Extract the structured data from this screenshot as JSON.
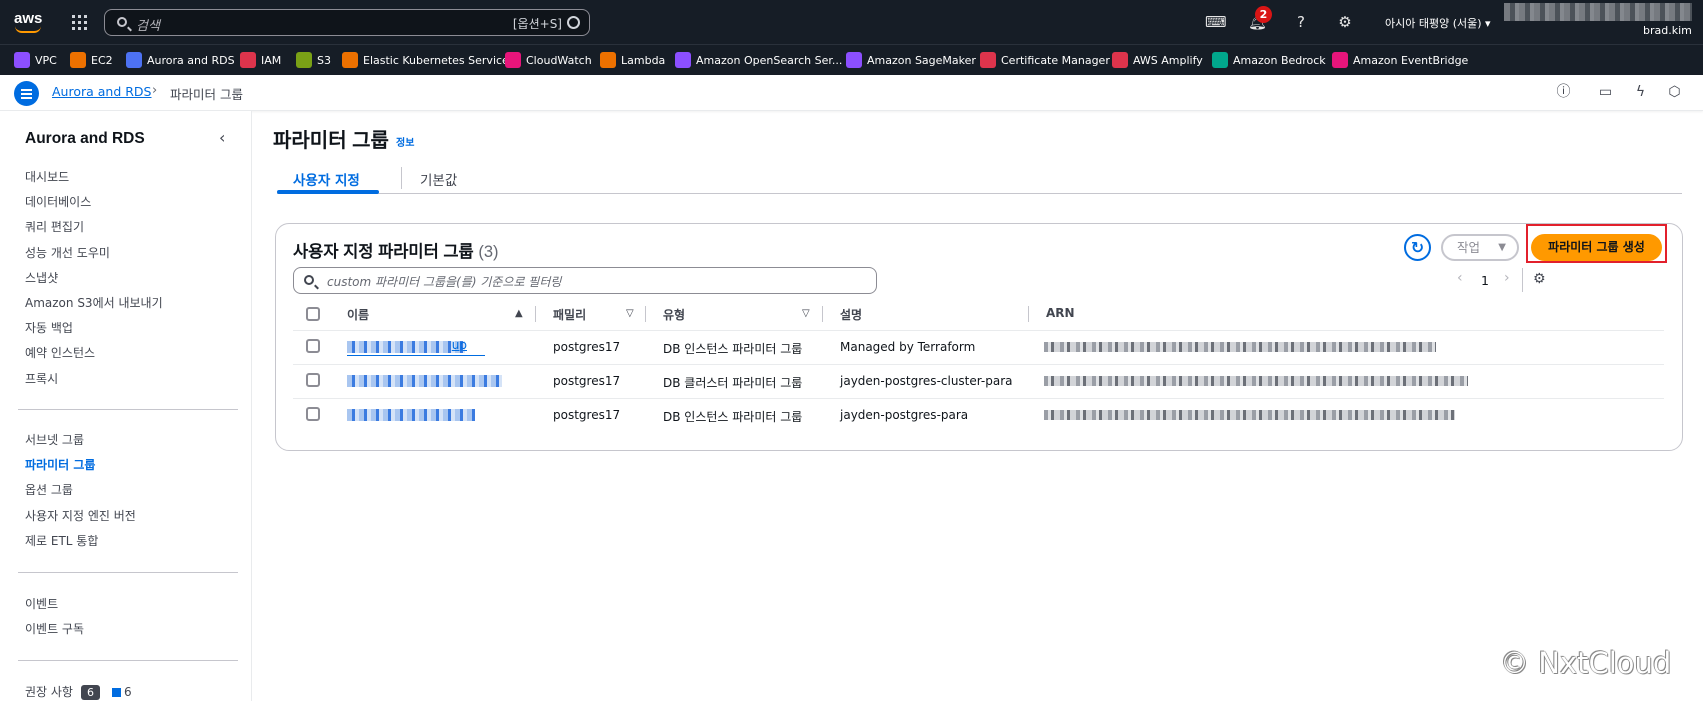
{
  "topbar": {
    "search_placeholder": "검색",
    "search_shortcut": "[옵션+S]",
    "notification_count": "2",
    "region": "아시아 태평양 (서울)",
    "username": "brad.kim"
  },
  "favorites": [
    {
      "label": "VPC",
      "color": "#8c4fff"
    },
    {
      "label": "EC2",
      "color": "#ed7100"
    },
    {
      "label": "Aurora and RDS",
      "color": "#4d72f3"
    },
    {
      "label": "IAM",
      "color": "#dd344c"
    },
    {
      "label": "S3",
      "color": "#7aa116"
    },
    {
      "label": "Elastic Kubernetes Service",
      "color": "#ed7100"
    },
    {
      "label": "CloudWatch",
      "color": "#e7157b"
    },
    {
      "label": "Lambda",
      "color": "#ed7100"
    },
    {
      "label": "Amazon OpenSearch Ser...",
      "color": "#8c4fff"
    },
    {
      "label": "Amazon SageMaker",
      "color": "#8c4fff"
    },
    {
      "label": "Certificate Manager",
      "color": "#dd344c"
    },
    {
      "label": "AWS Amplify",
      "color": "#dd344c"
    },
    {
      "label": "Amazon Bedrock",
      "color": "#01a88d"
    },
    {
      "label": "Amazon EventBridge",
      "color": "#e7157b"
    }
  ],
  "breadcrumb": {
    "root": "Aurora and RDS",
    "current": "파라미터 그룹"
  },
  "sidebar": {
    "title": "Aurora and RDS",
    "group1": [
      "대시보드",
      "데이터베이스",
      "쿼리 편집기",
      "성능 개선 도우미",
      "스냅샷",
      "Amazon S3에서 내보내기",
      "자동 백업",
      "예약 인스턴스",
      "프록시"
    ],
    "group2": [
      "서브넷 그룹",
      "파라미터 그룹",
      "옵션 그룹",
      "사용자 지정 엔진 버전",
      "제로 ETL 통합"
    ],
    "group3": [
      "이벤트",
      "이벤트 구독"
    ],
    "recommendations_label": "권장 사항",
    "recommendations_count_dark": "6",
    "recommendations_count_blue": "6"
  },
  "page": {
    "title": "파라미터 그룹",
    "info": "정보",
    "tabs": [
      "사용자 지정",
      "기본값"
    ]
  },
  "panel": {
    "title": "사용자 지정 파라미터 그룹",
    "count": "(3)",
    "action_label": "작업",
    "create_label": "파라미터 그룹 생성",
    "filter_placeholder": "custom 파라미터 그룹을(를) 기준으로 필터링",
    "page_number": "1",
    "columns": [
      "이름",
      "패밀리",
      "유형",
      "설명",
      "ARN"
    ],
    "rows": [
      {
        "name_tail": "up",
        "family": "postgres17",
        "type": "DB 인스턴스 파라미터 그룹",
        "description": "Managed by Terraform"
      },
      {
        "name_tail": "",
        "family": "postgres17",
        "type": "DB 클러스터 파라미터 그룹",
        "description": "jayden-postgres-cluster-para"
      },
      {
        "name_tail": "",
        "family": "postgres17",
        "type": "DB 인스턴스 파라미터 그룹",
        "description": "jayden-postgres-para"
      }
    ]
  },
  "watermark": "© NxtCloud"
}
